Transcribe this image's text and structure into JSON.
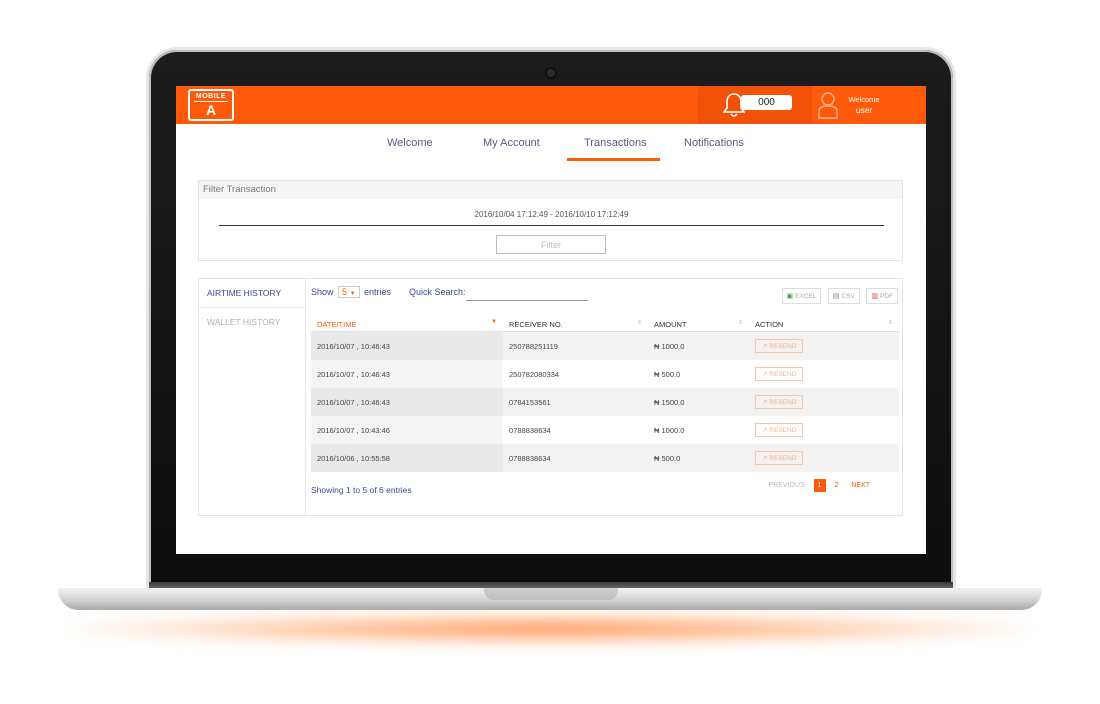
{
  "brand": {
    "line1": "MOBILE",
    "line2": "A",
    "accent": "#ff5a0a"
  },
  "header": {
    "notification_count": "000",
    "welcome": "Welcome",
    "username": "user"
  },
  "nav": {
    "tabs": [
      "Welcome",
      "My Account",
      "Transactions",
      "Notifications"
    ],
    "active": "Transactions"
  },
  "filter": {
    "title": "Filter Transaction",
    "date_range": "2016/10/04 17:12:49 - 2016/10/10 17:12:49",
    "button": "Filter"
  },
  "history": {
    "tabs": [
      "AIRTIME HISTORY",
      "WALLET HISTORY"
    ],
    "show_label": "Show",
    "entries_value": "5",
    "entries_label": "entries",
    "quick_search_label": "Quick Search:",
    "quick_search_value": "",
    "exports": [
      "EXCEL",
      "CSV",
      "PDF"
    ],
    "columns": [
      "DATE/TIME",
      "RECEIVER NO.",
      "AMOUNT",
      "ACTION"
    ],
    "rows": [
      {
        "datetime": "2016/10/07 , 10:46:43",
        "receiver": "250788251119",
        "amount": "₦ 1000.0",
        "action": "RESEND"
      },
      {
        "datetime": "2016/10/07 , 10:46:43",
        "receiver": "250782080334",
        "amount": "₦ 500.0",
        "action": "RESEND"
      },
      {
        "datetime": "2016/10/07 , 10:46:43",
        "receiver": "0784153561",
        "amount": "₦ 1500.0",
        "action": "RESEND"
      },
      {
        "datetime": "2016/10/07 , 10:43:46",
        "receiver": "0788838634",
        "amount": "₦ 1000.0",
        "action": "RESEND"
      },
      {
        "datetime": "2016/10/06 , 10:55:58",
        "receiver": "0788838634",
        "amount": "₦ 500.0",
        "action": "RESEND"
      }
    ],
    "showing": "Showing 1 to 5 of 6 entries",
    "pager": {
      "previous": "PREVIOUS",
      "pages": [
        "1",
        "2"
      ],
      "current": "1",
      "next": "NEXT"
    }
  }
}
